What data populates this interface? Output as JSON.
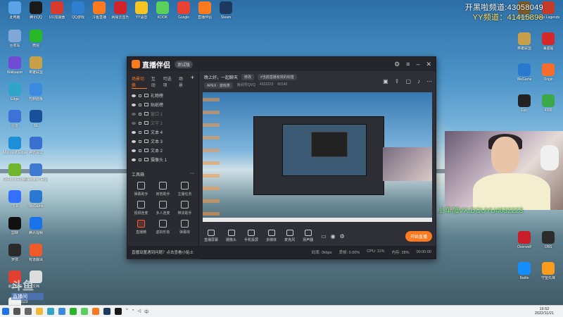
{
  "desktop": {
    "left_icons": [
      {
        "label": "此电脑",
        "color": "#5aa3e8"
      },
      {
        "label": "腾讯QQ",
        "color": "#1a1a1a"
      },
      {
        "label": "UU加速器",
        "color": "#d83a2e"
      },
      {
        "label": "QQ游戏",
        "color": "#2f7fd0"
      },
      {
        "label": "斗鱼直播",
        "color": "#ff7a1f"
      },
      {
        "label": "网易云音乐",
        "color": "#d2232a"
      },
      {
        "label": "YY语音",
        "color": "#f6c522"
      },
      {
        "label": "KOOK",
        "color": "#5ad05a"
      },
      {
        "label": "Google",
        "color": "#e94235"
      },
      {
        "label": "直播伴侣",
        "color": "#ff7a1f"
      },
      {
        "label": "Steam",
        "color": "#1b3a5e"
      },
      {
        "label": "回收站",
        "color": "#7fa9d4"
      },
      {
        "label": "微信",
        "color": "#27b82a"
      },
      {
        "label": "Wallpaper",
        "color": "#6f4bd6"
      },
      {
        "label": "英雄联盟",
        "color": "#c8a04a"
      },
      {
        "label": "Edge",
        "color": "#2fa5c9"
      },
      {
        "label": "控制面板",
        "color": "#3b8ae0"
      },
      {
        "label": "迅雷",
        "color": "#3f72d6"
      },
      {
        "label": "SE",
        "color": "#1a4f9a"
      },
      {
        "label": "Microsoft Edge",
        "color": "#1e8ed9"
      },
      {
        "label": "腾讯会议",
        "color": "#3b6fd0"
      },
      {
        "label": "GeForce Experience",
        "color": "#6fb52e"
      },
      {
        "label": "Wallpaper Engine",
        "color": "#3d7ad0"
      },
      {
        "label": "飞书",
        "color": "#3370ff"
      },
      {
        "label": "WeGame",
        "color": "#2b78d0"
      },
      {
        "label": "剪映",
        "color": "#111111"
      },
      {
        "label": "腾讯视频",
        "color": "#1a73e8"
      },
      {
        "label": "罗技",
        "color": "#2a2a2a"
      },
      {
        "label": "有道翻译",
        "color": "#ef5a2b"
      },
      {
        "label": "录屏软件",
        "color": "#e04030"
      },
      {
        "label": "文档",
        "color": "#dddddd"
      },
      {
        "label": "新建文件",
        "color": "#eeeeee"
      }
    ],
    "right_icons": [
      {
        "label": "炉石传说",
        "color": "#7a5a2a"
      },
      {
        "label": "Apex Legends",
        "color": "#c43b2b"
      },
      {
        "label": "英雄联盟",
        "color": "#c8a04a"
      },
      {
        "label": "海盗船",
        "color": "#d4282a"
      },
      {
        "label": "WeGame",
        "color": "#2b78d0"
      },
      {
        "label": "Origin",
        "color": "#f56c2d"
      },
      {
        "label": "Epic",
        "color": "#222222"
      },
      {
        "label": "4399",
        "color": "#3ba84a"
      },
      {
        "label": "Overwolf",
        "color": "#c81e2a"
      },
      {
        "label": "OBS",
        "color": "#2c2c2c"
      },
      {
        "label": "Battle",
        "color": "#148eff"
      },
      {
        "label": "守望先锋",
        "color": "#fa9c1e"
      }
    ],
    "overlay_line1": "开黑啦频道:43058049",
    "overlay_line2": "YY频道：41415898",
    "cam_caption": "上车加VX:DOUYU4632223",
    "watermark_logo": "斗鱼",
    "watermark_tag": "直播间",
    "watermark_room": "4632223"
  },
  "app": {
    "name": "直播伴侣",
    "version": "测试版",
    "left_tabs": [
      "场景切换",
      "互动",
      "可选项",
      "场景"
    ],
    "layers": [
      {
        "name": "礼物榜",
        "visible": true
      },
      {
        "name": "贴纸榜",
        "visible": true
      },
      {
        "name": "窗口 1",
        "visible": false
      },
      {
        "name": "文字 1",
        "visible": false
      },
      {
        "name": "文本 4",
        "visible": true
      },
      {
        "name": "文本 3",
        "visible": true
      },
      {
        "name": "文本 2",
        "visible": true
      },
      {
        "name": "摄像头 1",
        "visible": true
      }
    ],
    "tools_title": "工具箱",
    "tools": [
      {
        "label": "弹幕助手"
      },
      {
        "label": "房管助手"
      },
      {
        "label": "主播任务"
      },
      {
        "label": "视频连麦"
      },
      {
        "label": "多人连麦"
      },
      {
        "label": "带货助手"
      },
      {
        "label": "直播精"
      },
      {
        "label": "虚拟形象"
      },
      {
        "label": "弹幕库"
      }
    ],
    "room_title": "晚上好，一起聊天",
    "room_tag": "修改",
    "room_notice": "#当前直播有效的标签",
    "room_category": "APEX · 游戏类",
    "room_id_label": "房间号QVQ",
    "room_id": "4632223",
    "room_fans": "60140",
    "bottom_tools": [
      {
        "label": "直播屏幕"
      },
      {
        "label": "摄像头"
      },
      {
        "label": "手机投屏"
      },
      {
        "label": "多媒体"
      },
      {
        "label": "麦克风"
      },
      {
        "label": "扬声器"
      }
    ],
    "go_live": "开始直播",
    "status_tip": "直播设置遇到问题？点击查看小贴士",
    "status_stats": [
      "码率: 0kbps",
      "丢帧: 0.00%",
      "CPU: 11%",
      "内存: 38%"
    ],
    "status_timer": "00:00:00"
  },
  "taskbar": {
    "time": "16:52",
    "date": "2022/11/21",
    "lang": "中",
    "icons": [
      {
        "name": "start",
        "color": "#1a73e8"
      },
      {
        "name": "search",
        "color": "#555555"
      },
      {
        "name": "task-view",
        "color": "#666666"
      },
      {
        "name": "explorer",
        "color": "#f2b733"
      },
      {
        "name": "edge",
        "color": "#2fa5c9"
      },
      {
        "name": "store",
        "color": "#3b8ae0"
      },
      {
        "name": "wechat",
        "color": "#27b82a"
      },
      {
        "name": "kook",
        "color": "#5ad05a"
      },
      {
        "name": "douyu",
        "color": "#ff7a1f"
      },
      {
        "name": "steam",
        "color": "#1b3a5e"
      },
      {
        "name": "qq",
        "color": "#1a1a1a"
      }
    ]
  }
}
